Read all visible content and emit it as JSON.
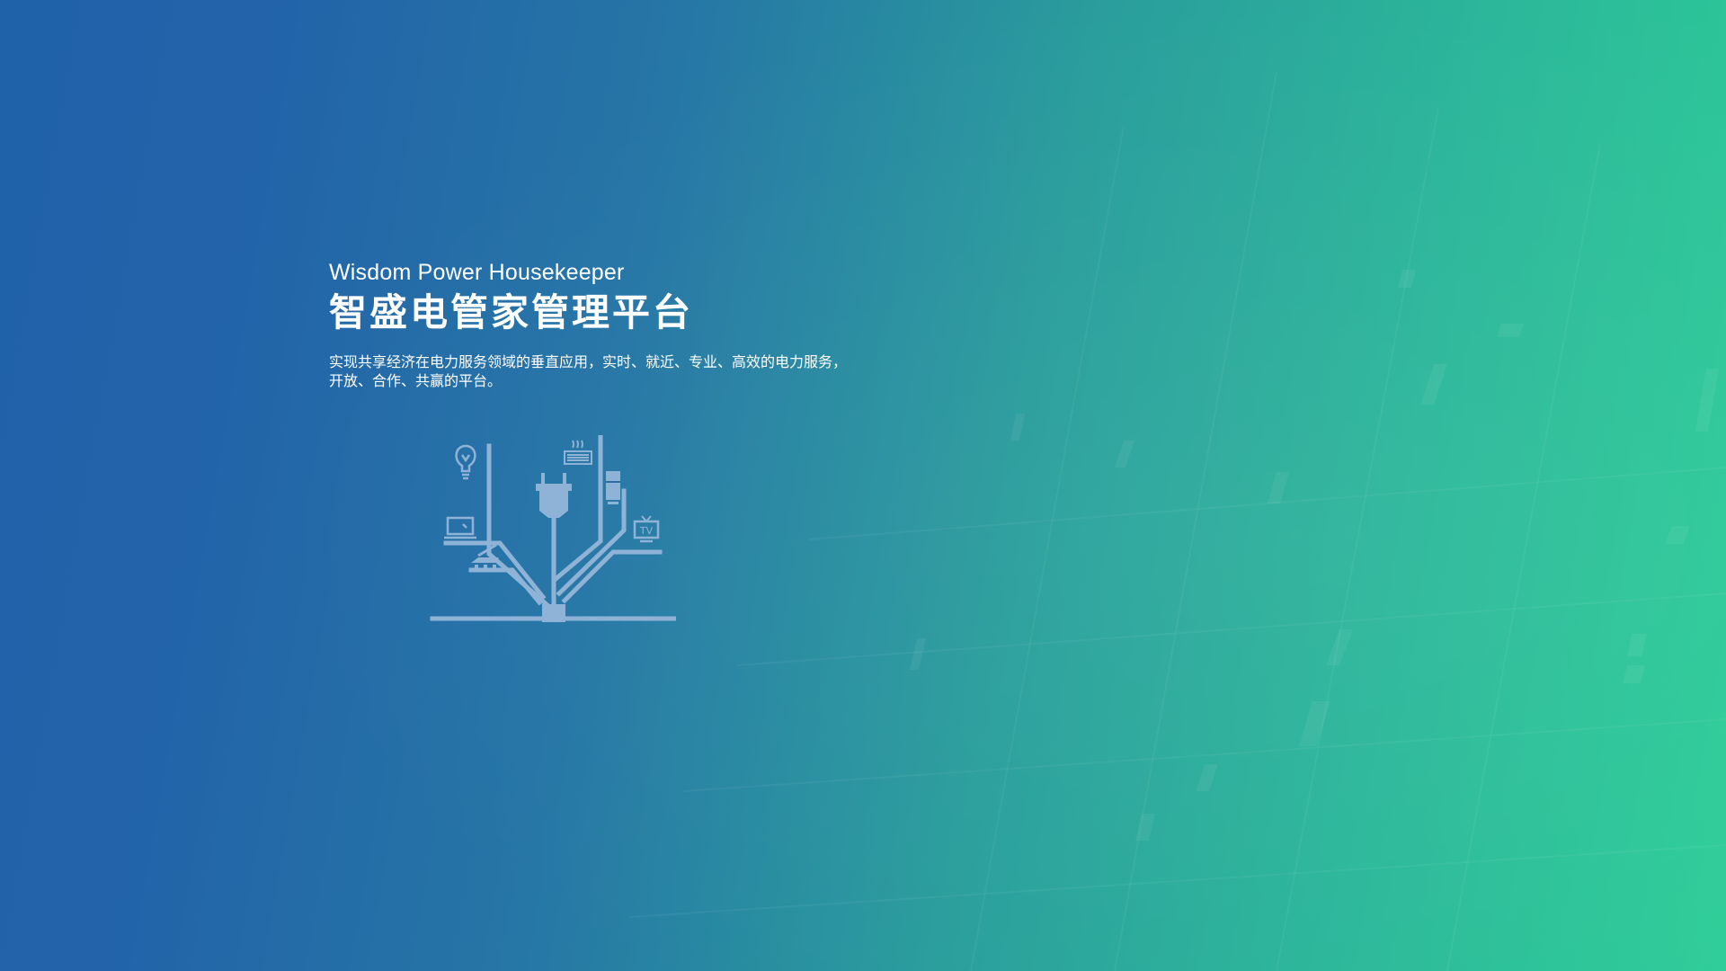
{
  "hero": {
    "subtitle_en": "Wisdom Power Housekeeper",
    "title_cn": "智盛电管家管理平台",
    "description": "实现共享经济在电力服务领域的垂直应用，实时、就近、专业、高效的电力服务，开放、合作、共赢的平台。"
  },
  "illustration": {
    "icons": [
      "lightbulb-icon",
      "plug-icon",
      "air-conditioner-icon",
      "refrigerator-icon",
      "laptop-icon",
      "television-icon",
      "iron-icon"
    ],
    "tv_label": "TV"
  },
  "colors": {
    "gradient_start": "#2062aa",
    "gradient_end": "#2ecd98",
    "text": "#ffffff",
    "illustration": "#8fb3d6"
  }
}
